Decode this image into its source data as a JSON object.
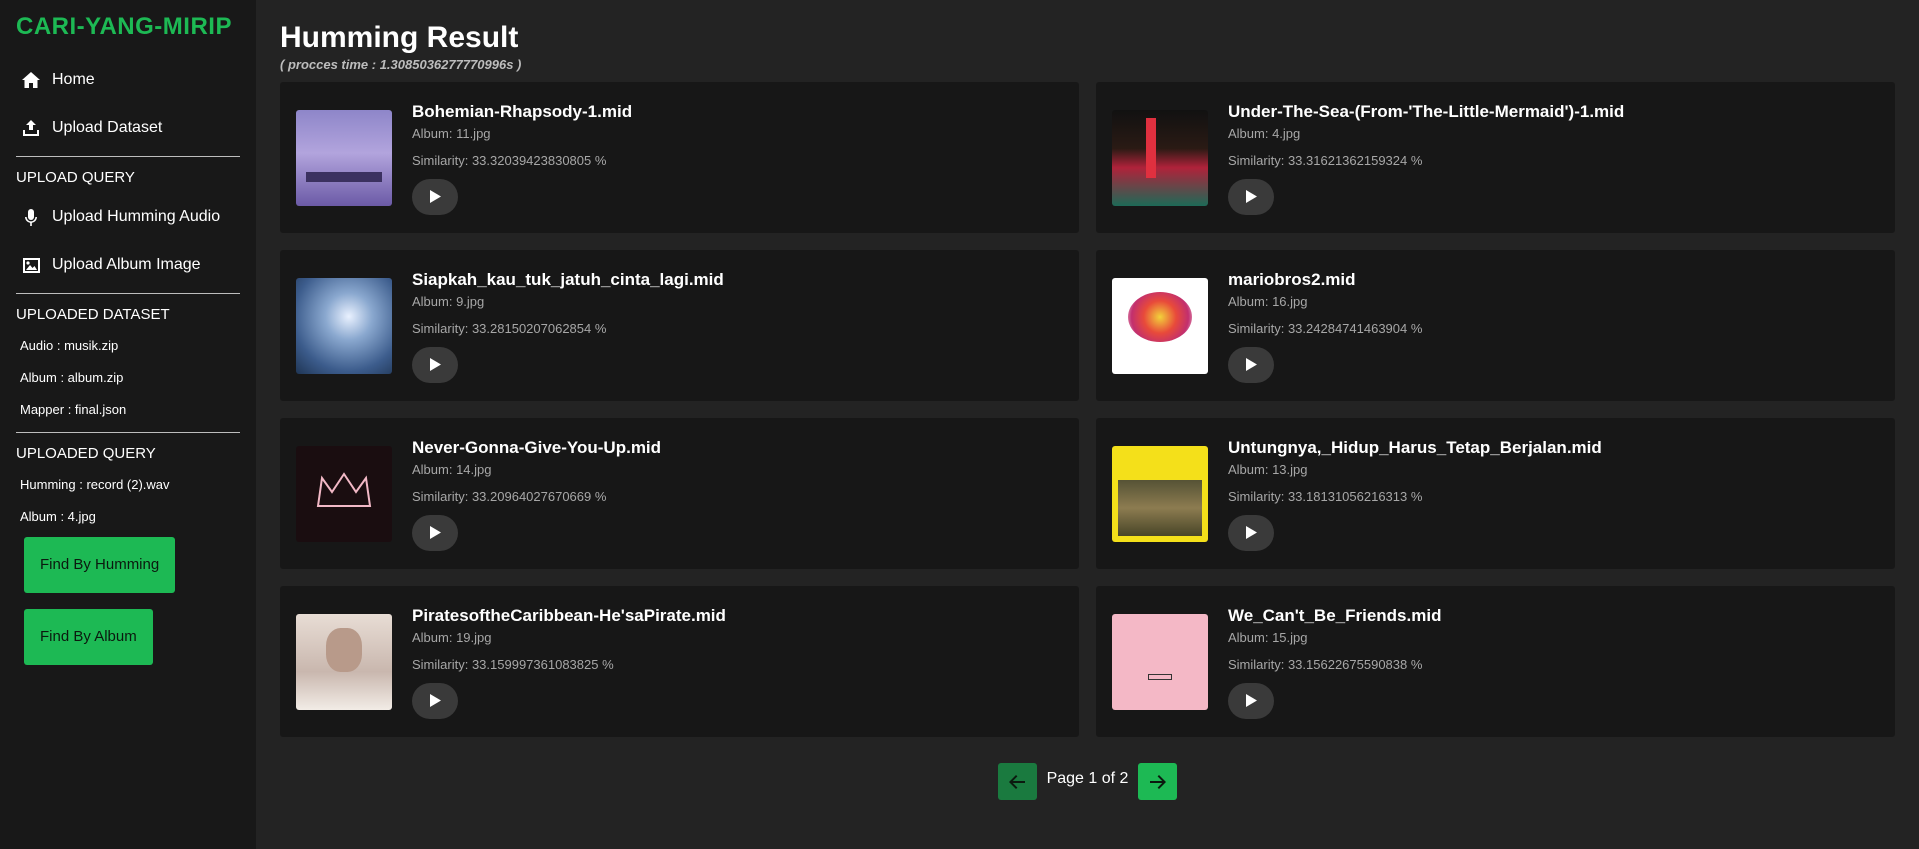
{
  "brand": "CARI-YANG-MIRIP",
  "nav": [
    {
      "label": "Home",
      "icon": "home-icon"
    },
    {
      "label": "Upload Dataset",
      "icon": "upload-icon"
    }
  ],
  "upload_query": {
    "title": "UPLOAD QUERY",
    "items": [
      {
        "label": "Upload Humming Audio",
        "icon": "microphone-icon"
      },
      {
        "label": "Upload Album Image",
        "icon": "image-icon"
      }
    ]
  },
  "uploaded_dataset": {
    "title": "UPLOADED DATASET",
    "audio": "Audio : musik.zip",
    "album": "Album : album.zip",
    "mapper": "Mapper : final.json"
  },
  "uploaded_query": {
    "title": "UPLOADED QUERY",
    "humming": "Humming : record (2).wav",
    "album": "Album : 4.jpg"
  },
  "buttons": {
    "find_humming": "Find By Humming",
    "find_album": "Find By Album"
  },
  "main": {
    "title": "Humming Result",
    "process_time": "( procces time : 1.3085036277770996s )"
  },
  "results": [
    {
      "title": "Bohemian-Rhapsody-1.mid",
      "album": "Album: 11.jpg",
      "similarity": "Similarity: 33.32039423830805 %"
    },
    {
      "title": "Under-The-Sea-(From-'The-Little-Mermaid')-1.mid",
      "album": "Album: 4.jpg",
      "similarity": "Similarity: 33.31621362159324 %"
    },
    {
      "title": "Siapkah_kau_tuk_jatuh_cinta_lagi.mid",
      "album": "Album: 9.jpg",
      "similarity": "Similarity: 33.28150207062854 %"
    },
    {
      "title": "mariobros2.mid",
      "album": "Album: 16.jpg",
      "similarity": "Similarity: 33.24284741463904 %"
    },
    {
      "title": "Never-Gonna-Give-You-Up.mid",
      "album": "Album: 14.jpg",
      "similarity": "Similarity: 33.20964027670669 %"
    },
    {
      "title": "Untungnya,_Hidup_Harus_Tetap_Berjalan.mid",
      "album": "Album: 13.jpg",
      "similarity": "Similarity: 33.18131056216313 %"
    },
    {
      "title": "PiratesoftheCaribbean-He'saPirate.mid",
      "album": "Album: 19.jpg",
      "similarity": "Similarity: 33.159997361083825 %"
    },
    {
      "title": "We_Can't_Be_Friends.mid",
      "album": "Album: 15.jpg",
      "similarity": "Similarity: 33.15622675590838 %"
    }
  ],
  "pagination": {
    "text": "Page 1 of 2"
  },
  "colors": {
    "accent": "#1db954",
    "sidebar_bg": "#181818",
    "main_bg": "#232323",
    "card_bg": "#171717"
  }
}
